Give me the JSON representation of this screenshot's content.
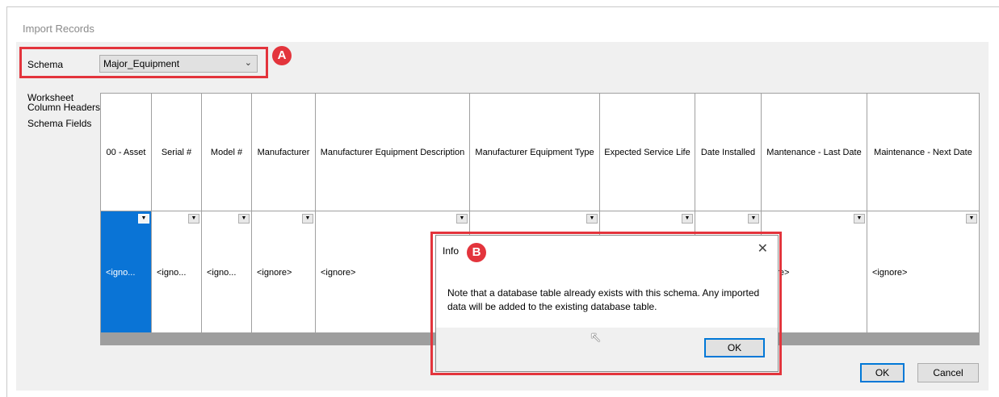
{
  "window": {
    "title": "Import Records"
  },
  "schema": {
    "label": "Schema",
    "selected": "Major_Equipment"
  },
  "side_labels": {
    "worksheet_headers": "Worksheet\nColumn Headers",
    "schema_fields": "Schema Fields"
  },
  "columns": [
    {
      "header": "00 - Asset",
      "value": "<igno...",
      "selected": true
    },
    {
      "header": "Serial #",
      "value": "<igno..."
    },
    {
      "header": "Model #",
      "value": "<igno..."
    },
    {
      "header": "Manufacturer",
      "value": "<ignore>"
    },
    {
      "header": "Manufacturer Equipment Description",
      "value": "<ignore>"
    },
    {
      "header": "Manufacturer Equipment Type",
      "value": ""
    },
    {
      "header": "Expected Service Life",
      "value": ""
    },
    {
      "header": "Date Installed",
      "value": ""
    },
    {
      "header": "Mantenance - Last Date",
      "value": "nore>"
    },
    {
      "header": "Maintenance - Next Date",
      "value": "<ignore>"
    }
  ],
  "buttons": {
    "ok": "OK",
    "cancel": "Cancel"
  },
  "dialog": {
    "title": "Info",
    "message": "Note that a database table already exists with this schema. Any imported data will be added to the existing database table.",
    "ok": "OK"
  },
  "annotations": {
    "a": "A",
    "b": "B"
  },
  "icons": {
    "dropdown": "chevron-down-icon",
    "close": "close-icon",
    "cell-dropdown": "triangle-down-icon",
    "cursor": "mouse-cursor-icon"
  },
  "colors": {
    "accent": "#0a74d6",
    "annotation": "#e3343c"
  }
}
